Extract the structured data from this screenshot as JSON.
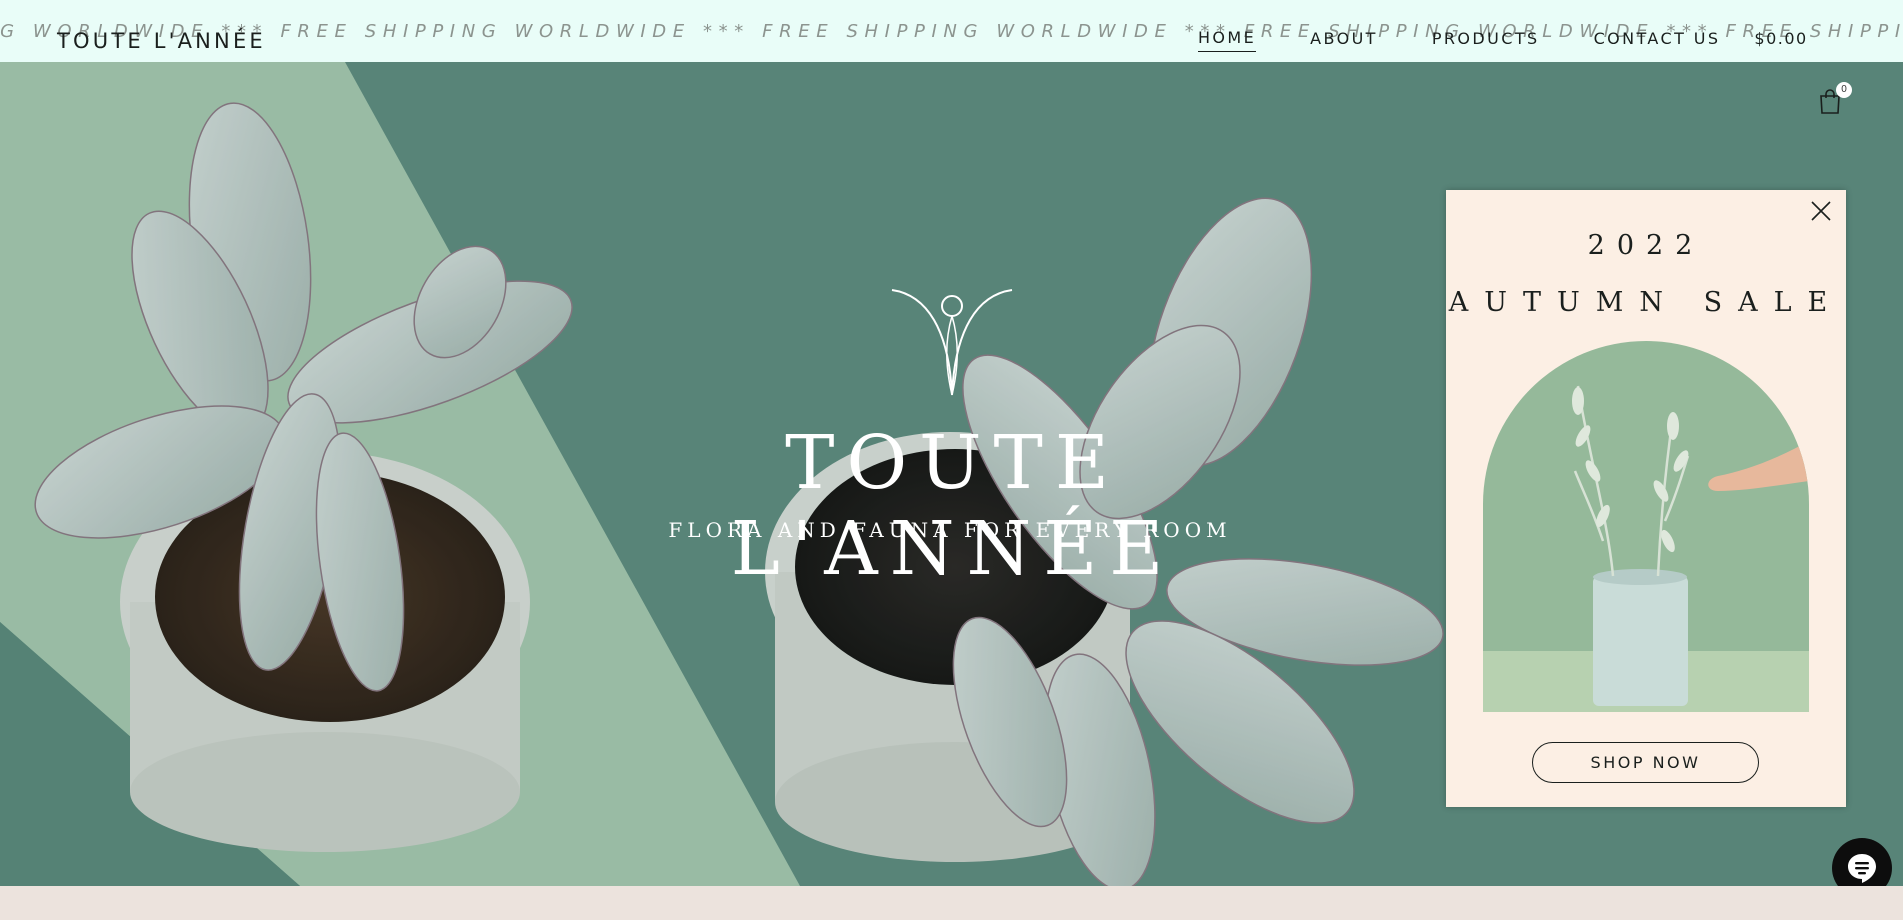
{
  "announcement": {
    "text": "NG WORLDWIDE *** FREE SHIPPING WORLDWIDE *** FREE SHIPPING WORLDWIDE *** FREE SHIPPING WORLDWIDE *** FREE SHIPPING WORLDWIDE *** FREE SHIP"
  },
  "header": {
    "brand": "TOUTE L'ANNÉE",
    "nav": [
      {
        "label": "HOME",
        "active": true
      },
      {
        "label": "ABOUT",
        "active": false
      },
      {
        "label": "PRODUCTS",
        "active": false
      },
      {
        "label": "CONTACT US",
        "active": false
      }
    ],
    "cart_amount": "$0.00",
    "cart_count": "0"
  },
  "hero": {
    "title": "TOUTE L'ANNÉE",
    "subtitle": "FLORA AND FAUNA FOR EVERY ROOM"
  },
  "popup": {
    "year": "2022",
    "title": "AUTUMN SALE",
    "button": "SHOP NOW"
  },
  "icons": {
    "close": "close-icon",
    "cart": "shopping-bag-icon",
    "chat": "chat-icon",
    "logo": "flower-logo-icon"
  },
  "colors": {
    "announcement_bg": "#e9fdf8",
    "hero_teal": "#5e8b7f",
    "popup_bg": "#fcefe4",
    "text_dark": "#1a1f1d",
    "chat_bg": "#0d0d0d"
  }
}
